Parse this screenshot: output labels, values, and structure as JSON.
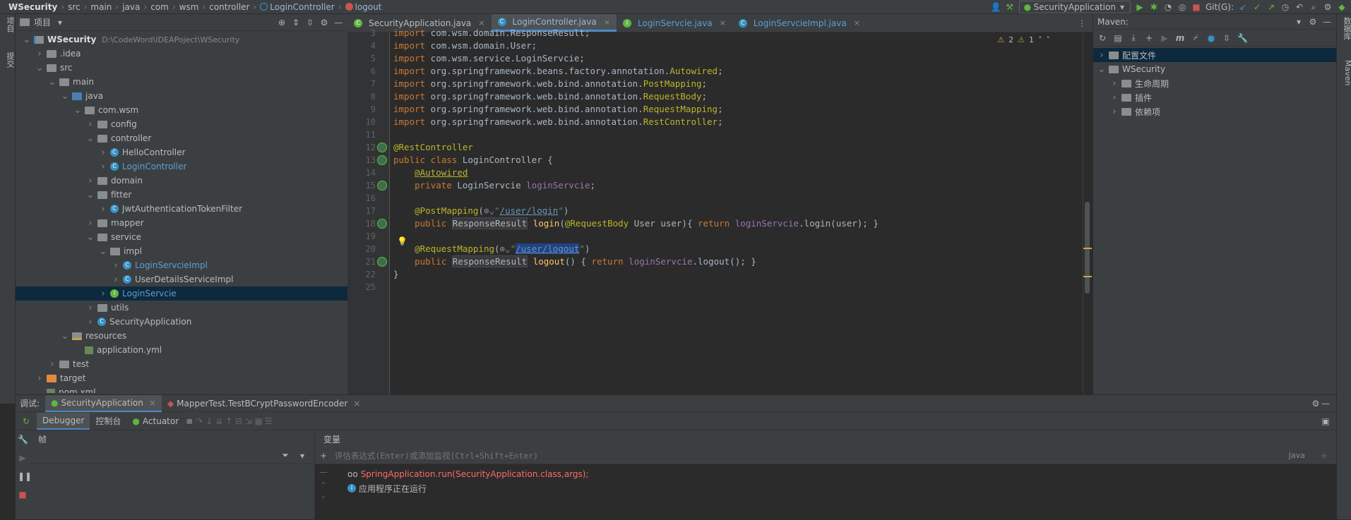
{
  "breadcrumb": [
    "WSecurity",
    "src",
    "main",
    "java",
    "com",
    "wsm",
    "controller",
    "LoginController",
    "logout"
  ],
  "toolbar": {
    "run_config": "SecurityApplication",
    "git_label": "Git(G):"
  },
  "left_strip": {
    "project_tab": "项目",
    "commit_tab": "提交"
  },
  "right_strip": {
    "db_tab": "数据库",
    "maven_tab": "Maven"
  },
  "project": {
    "title": "项目",
    "tree": [
      {
        "label": "WSecurity",
        "depth": 0,
        "open": true,
        "icon": "mod",
        "bold": true,
        "path": "D:\\CodeWord\\IDEAPoject\\WSecurity"
      },
      {
        "label": ".idea",
        "depth": 1,
        "open": false,
        "icon": "dir"
      },
      {
        "label": "src",
        "depth": 1,
        "open": true,
        "icon": "dir"
      },
      {
        "label": "main",
        "depth": 2,
        "open": true,
        "icon": "dir"
      },
      {
        "label": "java",
        "depth": 3,
        "open": true,
        "icon": "src"
      },
      {
        "label": "com.wsm",
        "depth": 4,
        "open": true,
        "icon": "dir"
      },
      {
        "label": "config",
        "depth": 5,
        "open": false,
        "icon": "dir"
      },
      {
        "label": "controller",
        "depth": 5,
        "open": true,
        "icon": "dir"
      },
      {
        "label": "HelloController",
        "depth": 6,
        "open": false,
        "icon": "cls"
      },
      {
        "label": "LoginController",
        "depth": 6,
        "open": false,
        "icon": "cls",
        "blue": true
      },
      {
        "label": "domain",
        "depth": 5,
        "open": false,
        "icon": "dir"
      },
      {
        "label": "fitter",
        "depth": 5,
        "open": true,
        "icon": "dir"
      },
      {
        "label": "JwtAuthenticationTokenFilter",
        "depth": 6,
        "open": false,
        "icon": "cls"
      },
      {
        "label": "mapper",
        "depth": 5,
        "open": false,
        "icon": "dir"
      },
      {
        "label": "service",
        "depth": 5,
        "open": true,
        "icon": "dir"
      },
      {
        "label": "impl",
        "depth": 6,
        "open": true,
        "icon": "dir"
      },
      {
        "label": "LoginServcieImpl",
        "depth": 7,
        "open": false,
        "icon": "cls",
        "blue": true
      },
      {
        "label": "UserDetailsServiceImpl",
        "depth": 7,
        "open": false,
        "icon": "cls"
      },
      {
        "label": "LoginServcie",
        "depth": 6,
        "open": false,
        "icon": "int",
        "blue": true,
        "selected": true
      },
      {
        "label": "utils",
        "depth": 5,
        "open": false,
        "icon": "dir"
      },
      {
        "label": "SecurityApplication",
        "depth": 5,
        "open": false,
        "icon": "cls"
      },
      {
        "label": "resources",
        "depth": 3,
        "open": true,
        "icon": "res"
      },
      {
        "label": "application.yml",
        "depth": 4,
        "leaf": true,
        "icon": "yml"
      },
      {
        "label": "test",
        "depth": 2,
        "open": false,
        "icon": "dir"
      },
      {
        "label": "target",
        "depth": 1,
        "open": false,
        "icon": "tgt"
      },
      {
        "label": "pom.xml",
        "depth": 1,
        "leaf": true,
        "icon": "yml"
      }
    ]
  },
  "tabs": [
    {
      "label": "SecurityApplication.java",
      "active": false
    },
    {
      "label": "LoginController.java",
      "active": true
    },
    {
      "label": "LoginServcie.java",
      "active": false
    },
    {
      "label": "LoginServcieImpl.java",
      "active": false
    }
  ],
  "inspections": {
    "warnings": "2",
    "weak": "1"
  },
  "code_lines": [
    {
      "n": "3",
      "html": "<span class='kw'>import</span> com.wsm.domain.ResponseResult;"
    },
    {
      "n": "4",
      "html": "<span class='kw'>import</span> com.wsm.domain.User;"
    },
    {
      "n": "5",
      "html": "<span class='kw'>import</span> com.wsm.service.LoginServcie;"
    },
    {
      "n": "6",
      "html": "<span class='kw'>import</span> org.springframework.beans.factory.annotation.<span class='ann'>Autowired</span>;"
    },
    {
      "n": "7",
      "html": "<span class='kw'>import</span> org.springframework.web.bind.annotation.<span class='ann'>PostMapping</span>;"
    },
    {
      "n": "8",
      "html": "<span class='kw'>import</span> org.springframework.web.bind.annotation.<span class='ann'>RequestBody</span>;"
    },
    {
      "n": "9",
      "html": "<span class='kw'>import</span> org.springframework.web.bind.annotation.<span class='ann'>RequestMapping</span>;"
    },
    {
      "n": "10",
      "html": "<span class='kw'>import</span> org.springframework.web.bind.annotation.<span class='ann'>RestController</span>;"
    },
    {
      "n": "11",
      "html": ""
    },
    {
      "n": "12",
      "html": "<span class='ann'>@RestController</span>"
    },
    {
      "n": "13",
      "html": "<span class='kw'>public class</span> LoginController {"
    },
    {
      "n": "14",
      "html": "    <span class='ann und'>@Autowired</span>"
    },
    {
      "n": "15",
      "html": "    <span class='kw'>private</span> LoginServcie <span class='fld'>loginServcie</span>;"
    },
    {
      "n": "16",
      "html": ""
    },
    {
      "n": "17",
      "html": "    <span class='ann'>@PostMapping</span>(<span style='color:#888'>⊕⌄</span><span class='str'>\"<span class='lnk'>/user/login</span>\"</span>)"
    },
    {
      "n": "18",
      "html": "    <span class='kw'>public</span> <span class='hl'>ResponseResult</span> <span class='fn'>login</span>(<span class='ann'>@RequestBody</span> User user){ <span class='kw'>return</span> <span class='fld'>loginServcie</span>.login(user); }"
    },
    {
      "n": "19",
      "html": ""
    },
    {
      "n": "20",
      "html": "    <span class='ann'>@RequestMapping</span>(<span style='color:#888'>⊕⌄</span><span class='str'>\"<span class='lnk selt'>/user/logout</span>\"</span>)"
    },
    {
      "n": "21",
      "html": "    <span class='kw'>public</span> <span class='hl'>ResponseResult</span> <span class='fn'>logout</span>() { <span class='kw'>return</span> <span class='fld'>loginServcie</span>.logout(); }"
    },
    {
      "n": "22",
      "html": "}"
    },
    {
      "n": "25",
      "html": ""
    }
  ],
  "maven": {
    "title": "Maven:",
    "items": [
      {
        "label": "配置文件",
        "depth": 0
      },
      {
        "label": "WSecurity",
        "depth": 0,
        "open": true
      },
      {
        "label": "生命周期",
        "depth": 1
      },
      {
        "label": "插件",
        "depth": 1
      },
      {
        "label": "依赖项",
        "depth": 1
      }
    ]
  },
  "debug": {
    "label": "调试:",
    "sessions": [
      {
        "label": "SecurityApplication",
        "active": true
      },
      {
        "label": "MapperTest.TestBCryptPasswordEncoder",
        "active": false
      }
    ],
    "subtabs": [
      "Debugger",
      "控制台",
      "Actuator"
    ],
    "frames_header": "帧",
    "vars_header": "变量",
    "eval_placeholder": "评估表达式(Enter)或添加监视(Ctrl+Shift+Enter)",
    "lang": "Java",
    "var_lines": [
      "SpringApplication.run(SecurityApplication.class,args);",
      "应用程序正在运行"
    ]
  },
  "colors": {
    "accent": "#4a88c7",
    "selected_row": "#0d293e",
    "editor_bg": "#2b2b2b",
    "panel_bg": "#3c3f41"
  }
}
